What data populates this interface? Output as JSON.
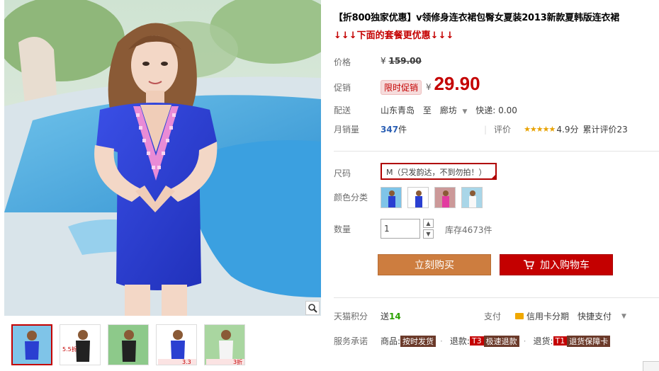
{
  "product": {
    "title": "【折800独家优惠】v领修身连衣裙包臀女夏装2013新款夏韩版连衣裙",
    "subtitle": "↓↓↓下面的套餐更优惠↓↓↓"
  },
  "price": {
    "label": "价格",
    "currency": "¥",
    "original": "159.00"
  },
  "promo": {
    "label": "促销",
    "tag": "限时促销",
    "currency": "¥",
    "price": "29.90"
  },
  "shipping": {
    "label": "配送",
    "from": "山东青岛",
    "to_word": "至",
    "dest": "廊坊",
    "express": "快递: 0.00"
  },
  "sales": {
    "label": "月销量",
    "count": "347",
    "unit": "件",
    "review_label": "评价",
    "stars": "★★★★★",
    "score": "4.9分",
    "accum": "累计评价23"
  },
  "size": {
    "label": "尺码",
    "selected": "M（只发韵达，不到勿拍！）"
  },
  "color": {
    "label": "颜色分类",
    "swatches": [
      "blue-dress-swatch",
      "blue-dress-swatch-2",
      "pink-dress-swatch",
      "white-dress-swatch"
    ]
  },
  "quantity": {
    "label": "数量",
    "value": "1",
    "stock": "库存4673件"
  },
  "buttons": {
    "buy": "立刻购买",
    "cart": "加入购物车"
  },
  "points": {
    "label": "天猫积分",
    "prefix": "送",
    "value": "14"
  },
  "payment": {
    "label": "支付",
    "credit": "信用卡分期",
    "quick": "快捷支付"
  },
  "service": {
    "label": "服务承诺",
    "item1_prefix": "商品:",
    "item1_tag": "按时发货",
    "item2_prefix": "退款:",
    "item2_tag_a": "T3",
    "item2_tag_b": "极速退款",
    "item3_prefix": "退货:",
    "item3_tag_a": "T1",
    "item3_tag_b": "退货保障卡"
  },
  "thumb_tags": {
    "t2": "5.5折",
    "t4": "3.3折",
    "t5": "3折"
  },
  "colors": {
    "accent_red": "#c40000",
    "buy_orange": "#cd7d3f",
    "link_blue": "#2b5fb4",
    "dress_blue": "#2a3fd1"
  }
}
